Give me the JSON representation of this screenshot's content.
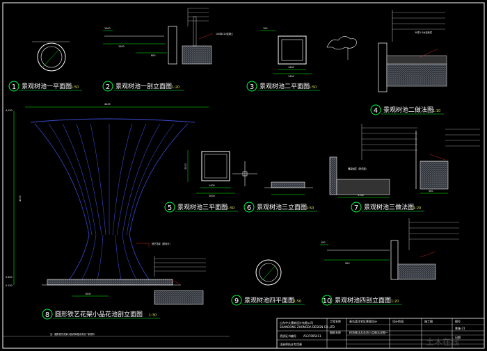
{
  "colors": {
    "background": "#000000",
    "frame": "#ffffff",
    "dimension": "#00ff00",
    "tree_frame": "#3a4ad0",
    "leader": "#ff3030",
    "title_circle": "#00ff40",
    "hatch": "#9aa0a8",
    "note_text": "#ffffff"
  },
  "drawings": [
    {
      "num": "1",
      "title": "景观树池一平面图",
      "scale": "1:50"
    },
    {
      "num": "2",
      "title": "景观树池一剖立面图",
      "scale": "1:20"
    },
    {
      "num": "3",
      "title": "景观树池二平面图",
      "scale": "1:50"
    },
    {
      "num": "4",
      "title": "景观树池二做法图",
      "scale": "1:10"
    },
    {
      "num": "5",
      "title": "景观树池三平面图",
      "scale": "1:50"
    },
    {
      "num": "6",
      "title": "景观树池三立面图",
      "scale": "1:50"
    },
    {
      "num": "7",
      "title": "景观树池三做法图",
      "scale": "1:20"
    },
    {
      "num": "8",
      "title": "圆形铁艺花架小品花池剖立面图",
      "scale": "1:30"
    },
    {
      "num": "9",
      "title": "景观树池四平面图",
      "scale": "1:50"
    },
    {
      "num": "10",
      "title": "景观树池四剖立面图",
      "scale": "1:20"
    }
  ],
  "dimensions": {
    "d2_top": "1000",
    "d2_left": "1000",
    "d2_mid": "800",
    "d3_left": "100",
    "d3_mid": "1400",
    "d3_bot": "1400",
    "d8_top": "4445",
    "d8_left_top": "4,150",
    "d8_height": "4000",
    "d8_base": "1000",
    "d8_left_a": "0.600",
    "d8_left_b": "0.150",
    "d5_w": "1400",
    "d5_w2": "2000",
    "d5_left": "2000",
    "d7_a": "1700",
    "d7_b": "500",
    "d10_a": "900",
    "d10_b": "100"
  },
  "notes": {
    "n2": "100厚C20混凝土",
    "n3": "30厚1:3水泥砂浆",
    "n7": "铺装面层（按总图）",
    "n8": "铁艺花架（按设计）"
  },
  "drawing8_footnote": "注：圆形铁艺花架小品具体做法详见厂家资料",
  "title_block": {
    "company": "山东中大建筑设计有限公司",
    "company_en": "SHANDONG ZHONGDA DESIGN CO.,LTD",
    "license_label": "资质证书编号",
    "license_no": "A137005411",
    "seal_label": "注册师执业专用章",
    "project_label": "工程名称",
    "project": "青岛某住宅区景观设计",
    "drawing_label": "图纸名称",
    "drawing": "树池做法及花池小品做法详图一",
    "stage_label": "设计阶段",
    "stage": "施工图",
    "number_label": "图号",
    "number": "景施-21",
    "date_label": "日期",
    "watermark": "土木在线"
  }
}
